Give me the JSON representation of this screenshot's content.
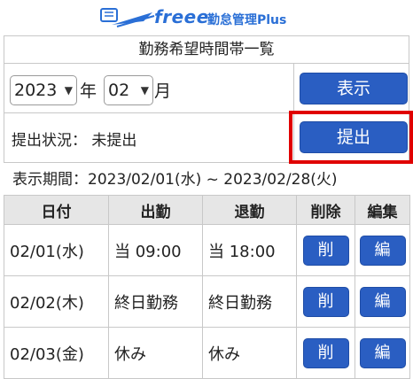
{
  "header": {
    "brand": "freee",
    "product": "勤怠管理Plus"
  },
  "page_title": "勤務希望時間帯一覧",
  "controls": {
    "year_value": "2023",
    "year_unit": "年",
    "month_value": "02",
    "month_unit": "月",
    "show_button": "表示"
  },
  "status": {
    "text": "提出状況： 未提出",
    "submit_button": "提出"
  },
  "period": "表示期間：2023/02/01(水) ~ 2023/02/28(火)",
  "table": {
    "headers": [
      "日付",
      "出勤",
      "退勤",
      "削除",
      "編集"
    ],
    "rows": [
      {
        "date": "02/01(水)",
        "start": "当 09:00",
        "end": "当 18:00",
        "delete": "削",
        "edit": "編"
      },
      {
        "date": "02/02(木)",
        "start": "終日勤務",
        "end": "終日勤務",
        "delete": "削",
        "edit": "編"
      },
      {
        "date": "02/03(金)",
        "start": "休み",
        "end": "休み",
        "delete": "削",
        "edit": "編"
      }
    ]
  },
  "colors": {
    "accent": "#2a5ec2",
    "highlight": "#e00000"
  }
}
